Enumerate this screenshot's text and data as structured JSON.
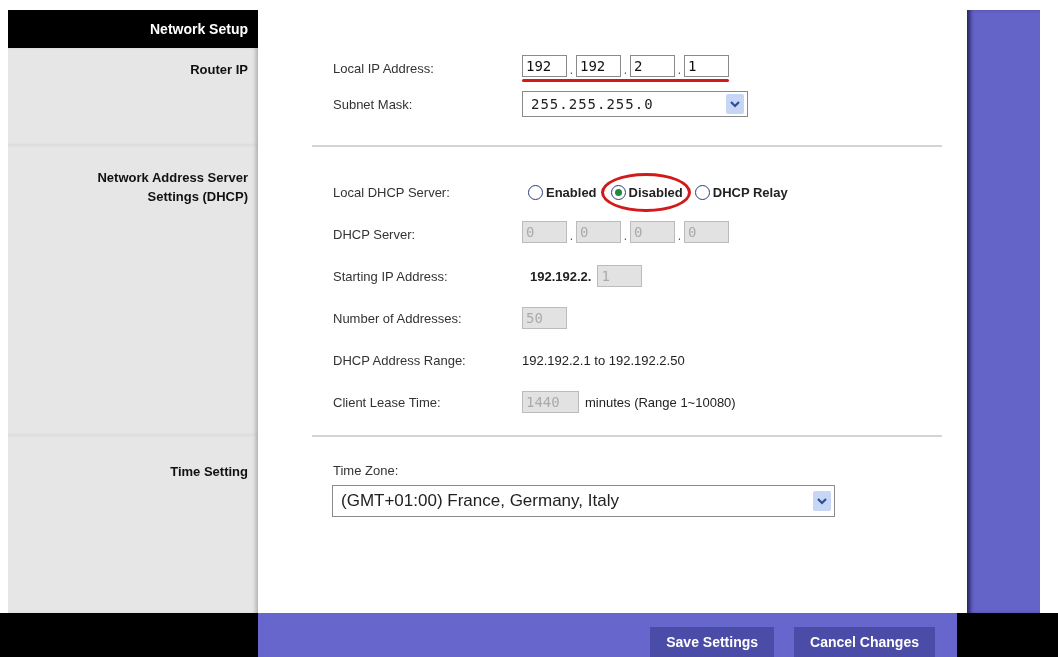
{
  "sidebar": {
    "title": "Network Setup"
  },
  "sections": [
    {
      "heading": "Router IP",
      "rows": [
        {
          "kind": "ip",
          "label": "Local IP Address:",
          "octets": [
            "192",
            "192",
            "2",
            "1"
          ],
          "separator": ".",
          "disabled": false,
          "highlighted": true
        },
        {
          "kind": "select",
          "label": "Subnet Mask:",
          "value": "255.255.255.0"
        }
      ]
    },
    {
      "heading": "Network Address Server Settings (DHCP)",
      "rows": [
        {
          "kind": "radio",
          "label": "Local DHCP Server:",
          "options": [
            {
              "label": "Enabled",
              "selected": false,
              "highlighted": false
            },
            {
              "label": "Disabled",
              "selected": true,
              "highlighted": true
            },
            {
              "label": "DHCP Relay",
              "selected": false,
              "highlighted": false
            }
          ]
        },
        {
          "kind": "ip",
          "label": "DHCP Server:",
          "octets": [
            "0",
            "0",
            "0",
            "0"
          ],
          "separator": ".",
          "disabled": true,
          "highlighted": false
        },
        {
          "kind": "input",
          "label": "Starting IP Address:",
          "prefix": "192.192.2.",
          "value": "1",
          "disabled": true
        },
        {
          "kind": "input",
          "label": "Number of Addresses:",
          "value": "50",
          "disabled": true
        },
        {
          "kind": "text",
          "label": "DHCP Address Range:",
          "value": "192.192.2.1 to 192.192.2.50"
        },
        {
          "kind": "input",
          "label": "Client Lease Time:",
          "value": "1440",
          "disabled": true,
          "suffix": "minutes (Range 1~10080)"
        }
      ]
    },
    {
      "heading": "Time Setting",
      "rows": [
        {
          "kind": "caption",
          "label": "Time Zone:"
        },
        {
          "kind": "wide-select",
          "value": "(GMT+01:00) France, Germany, Italy"
        }
      ]
    }
  ],
  "buttons": [
    "Save Settings",
    "Cancel Changes"
  ]
}
